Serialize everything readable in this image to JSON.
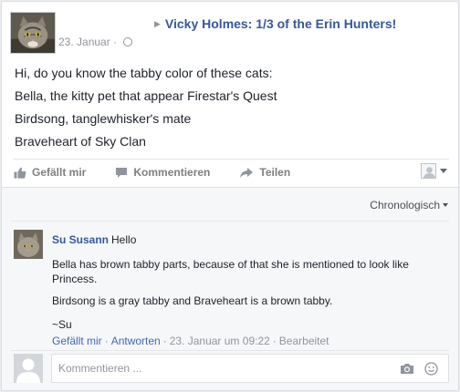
{
  "post": {
    "share_title": "Vicky Holmes: 1/3 of the Erin Hunters!",
    "date": "23. Januar",
    "date_separator": "·",
    "lines": [
      "Hi, do you know the tabby color of these cats:",
      "Bella, the kitty pet that appear Firestar's Quest",
      "Birdsong, tanglewhisker's mate",
      "Braveheart of Sky Clan"
    ]
  },
  "actions": {
    "like": "Gefällt mir",
    "comment": "Kommentieren",
    "share": "Teilen"
  },
  "comments_section": {
    "sort_label": "Chronologisch",
    "comment": {
      "author": "Su Susann",
      "first_text": "Hello",
      "paragraphs": [
        "Bella has brown tabby parts, because of that she is mentioned to look like Princess.",
        "Birdsong is a gray tabby and Braveheart is a brown tabby.",
        "~Su"
      ],
      "like_link": "Gefällt mir",
      "reply_link": "Antworten",
      "timestamp": "23. Januar um 09:22",
      "edited": "Bearbeitet",
      "separator": "·"
    },
    "input": {
      "placeholder": "Kommentieren ..."
    }
  },
  "icons": {
    "like": "thumbs-up-icon",
    "comment": "speech-bubble-icon",
    "share": "share-arrow-icon",
    "camera": "camera-icon",
    "emoji": "smiley-icon",
    "globe": "globe-icon"
  },
  "colors": {
    "link": "#365899",
    "muted": "#90949c",
    "action": "#7f7f7f"
  }
}
